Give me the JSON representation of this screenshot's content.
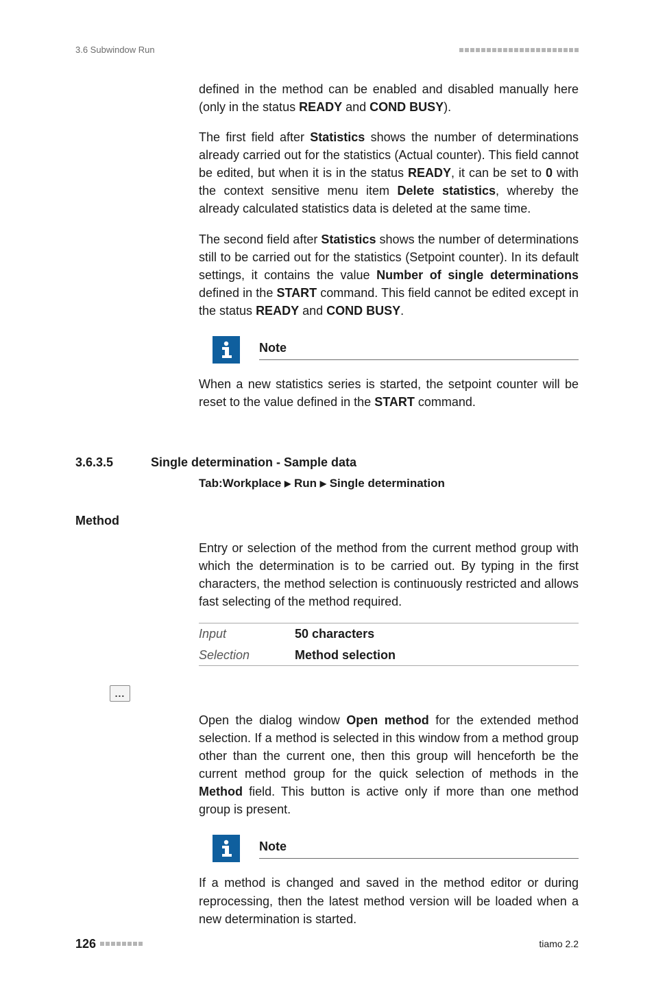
{
  "header": {
    "section_label": "3.6 Subwindow Run"
  },
  "body": {
    "para1_a": "defined in the method can be enabled and disabled manually here (only in the status ",
    "para1_b": "READY",
    "para1_c": " and ",
    "para1_d": "COND BUSY",
    "para1_e": ").",
    "para2_a": "The first field after ",
    "para2_b": "Statistics",
    "para2_c": " shows the number of determinations already carried out for the statistics (Actual counter). This field cannot be edited, but when it is in the status ",
    "para2_d": "READY",
    "para2_e": ", it can be set to ",
    "para2_f": "0",
    "para2_g": " with the context sensitive menu item ",
    "para2_h": "Delete statistics",
    "para2_i": ", whereby the already calculated statistics data is deleted at the same time.",
    "para3_a": "The second field after ",
    "para3_b": "Statistics",
    "para3_c": " shows the number of determinations still to be carried out for the statistics (Setpoint counter). In its default settings, it contains the value ",
    "para3_d": "Number of single determinations",
    "para3_e": " defined in the ",
    "para3_f": "START",
    "para3_g": " command. This field cannot be edited except in the status ",
    "para3_h": "READY",
    "para3_i": " and ",
    "para3_j": "COND BUSY",
    "para3_k": ".",
    "note1_label": "Note",
    "note1_a": "When a new statistics series is started, the setpoint counter will be reset to the value defined in the ",
    "note1_b": "START",
    "note1_c": " command.",
    "section_num": "3.6.3.5",
    "section_title": "Single determination - Sample data",
    "tab_a": "Tab:Workplace ",
    "tab_b": " Run ",
    "tab_c": " Single determination",
    "method_label": "Method",
    "method_para": "Entry or selection of the method from the current method group with which the determination is to be carried out. By typing in the first characters, the method selection is continuously restricted and allows fast selecting of the method required.",
    "table": {
      "r1_label": "Input",
      "r1_value": "50 characters",
      "r2_label": "Selection",
      "r2_value": "Method selection"
    },
    "ellipsis": "...",
    "open_a": "Open the dialog window ",
    "open_b": "Open method",
    "open_c": " for the extended method selection. If a method is selected in this window from a method group other than the current one, then this group will henceforth be the current method group for the quick selection of methods in the ",
    "open_d": "Method",
    "open_e": " field. This button is active only if more than one method group is present.",
    "note2_label": "Note",
    "note2_body": "If a method is changed and saved in the method editor or during reprocessing, then the latest method version will be loaded when a new determination is started."
  },
  "footer": {
    "page": "126",
    "product": "tiamo 2.2"
  }
}
